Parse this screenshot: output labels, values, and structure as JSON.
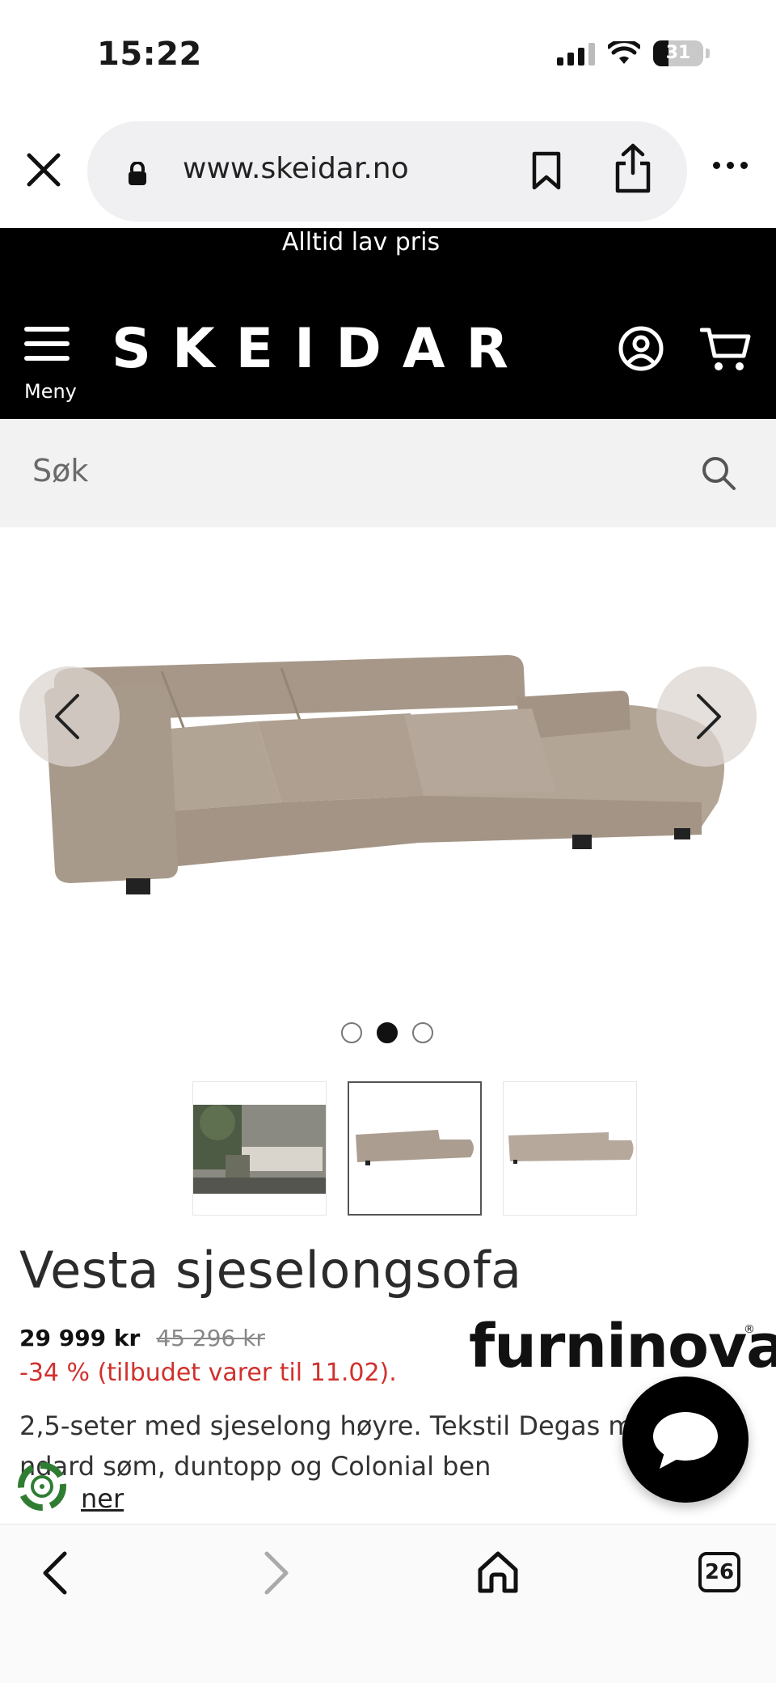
{
  "status_bar": {
    "time": "15:22",
    "battery": "31"
  },
  "browser": {
    "url": "www.skeidar.no",
    "tabs_count": "26"
  },
  "site": {
    "promo": "Alltid lav pris",
    "logo": "SKEIDAR",
    "menu_label": "Meny",
    "search_placeholder": "Søk"
  },
  "gallery": {
    "dot_count": 3,
    "active_dot": 2,
    "thumbnails": [
      "lifestyle",
      "sofa-front",
      "sofa-side"
    ],
    "active_thumbnail": 2
  },
  "product": {
    "title": "Vesta sjeselongsofa",
    "price": "29 999 kr",
    "old_price": "45 296 kr",
    "discount": "-34 % (tilbudet varer til 11.02).",
    "brand": "furninova",
    "description": "2,5-seter med sjeselong høyre. Tekstil Degas m... ndard søm, duntopp og Colonial ben",
    "read_more": "ner"
  },
  "colors": {
    "accent_red": "#d0312d",
    "header_bg": "#000000",
    "search_bg": "#f2f2f2",
    "sofa": "#b0a396"
  }
}
